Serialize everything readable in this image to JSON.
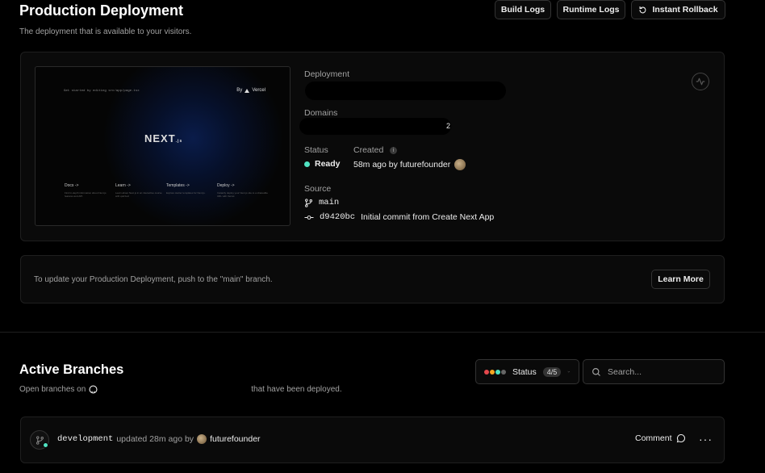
{
  "header": {
    "title": "Production Deployment",
    "subtitle": "The deployment that is available to your visitors.",
    "build_logs": "Build Logs",
    "runtime_logs": "Runtime Logs",
    "instant_rollback": "Instant Rollback"
  },
  "preview": {
    "get_started": "Get started by editing src/app/page.tsx",
    "by": "By",
    "vercel": "Vercel",
    "logo": "NEXT",
    "logo_suffix": ".js",
    "links": [
      {
        "title": "Docs ->",
        "desc": "Find in-depth information about Next.js features and API."
      },
      {
        "title": "Learn ->",
        "desc": "Learn about Next.js in an interactive course with quizzes!"
      },
      {
        "title": "Templates ->",
        "desc": "Explore starter templates for Next.js."
      },
      {
        "title": "Deploy ->",
        "desc": "Instantly deploy your Next.js site to a shareable URL with Vercel."
      }
    ]
  },
  "deployment": {
    "deployment_label": "Deployment",
    "domains_label": "Domains",
    "domains_count": "2",
    "status_label": "Status",
    "status_value": "Ready",
    "created_label": "Created",
    "created_value": "58m ago by futurefounder",
    "source_label": "Source",
    "branch": "main",
    "commit_hash": "d9420bc",
    "commit_message": "Initial commit from Create Next App"
  },
  "info": {
    "text": "To update your Production Deployment, push to the \"main\" branch.",
    "learn_more": "Learn More"
  },
  "active_branches": {
    "title": "Active Branches",
    "subtitle_prefix": "Open branches on",
    "subtitle_suffix": "that have been deployed.",
    "status_label": "Status",
    "status_count": "4/5",
    "search_placeholder": "Search...",
    "rows": [
      {
        "branch": "development",
        "updated": "updated 28m ago by",
        "user": "futurefounder",
        "comment": "Comment"
      }
    ]
  },
  "colors": {
    "ready": "#50e3c2",
    "background": "#000000",
    "card": "#0a0a0a"
  }
}
